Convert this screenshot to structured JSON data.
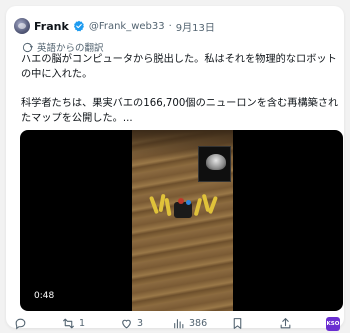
{
  "tweet": {
    "author_name": "Frank",
    "handle": "@Frank_web33",
    "separator": "·",
    "date": "9月13日",
    "translation_label": "英語からの翻訳",
    "paragraph_1": "ハエの脳がコンピュータから脱出した。私はそれを物理的なロボットの中に入れた。",
    "paragraph_2": "科学者たちは、果実バエの166,700個のニューロンを含む再構築されたマップを公開した。..."
  },
  "video": {
    "timestamp": "0:48"
  },
  "actions": {
    "reply_count": "",
    "retweet_count": "1",
    "like_count": "3",
    "views_count": "386"
  },
  "badge": {
    "label": "KSO",
    "color": "#6a2fd1"
  },
  "colors": {
    "verified": "#1d9bf0",
    "secondary_text": "#536471"
  }
}
